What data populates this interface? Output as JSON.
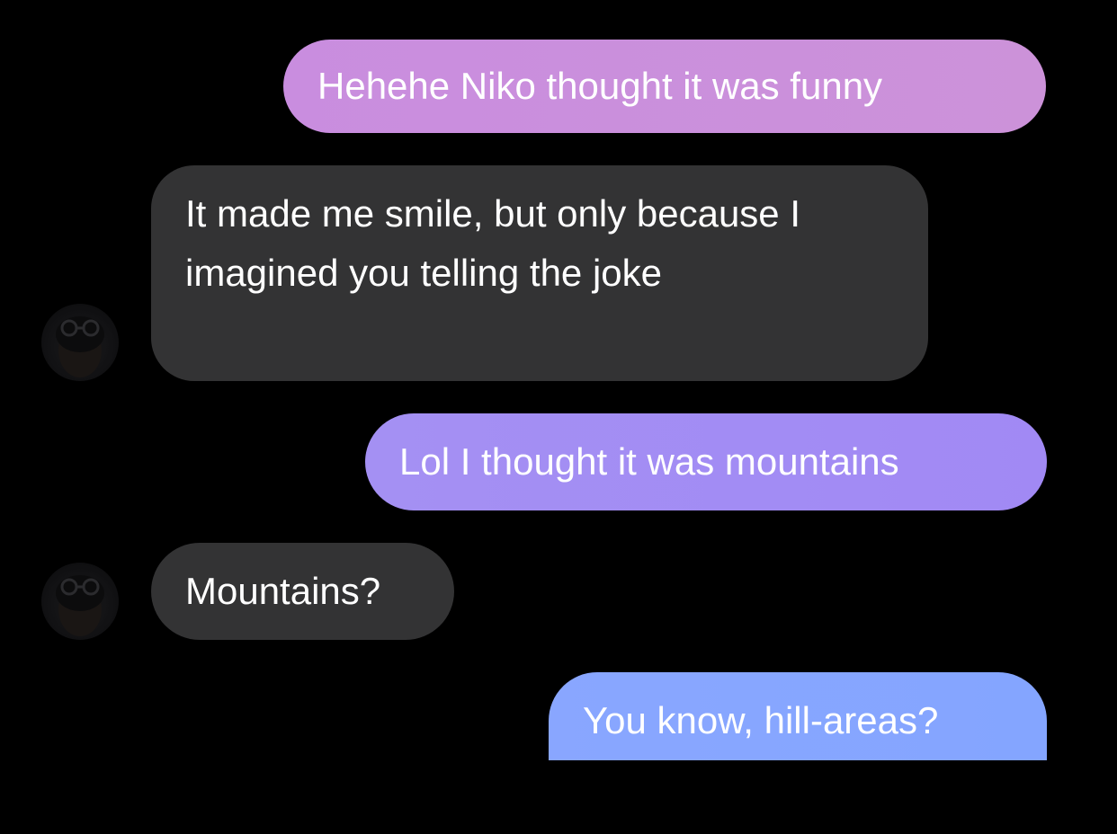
{
  "conversation": {
    "messages": [
      {
        "direction": "outgoing",
        "text": "Hehehe Niko thought it was funny"
      },
      {
        "direction": "incoming",
        "text": "It made me smile, but only because I imagined you telling the joke"
      },
      {
        "direction": "outgoing",
        "text": "Lol I thought it was mountains"
      },
      {
        "direction": "incoming",
        "text": "Mountains?"
      },
      {
        "direction": "outgoing",
        "text": "You know, hill-areas?"
      }
    ]
  },
  "colors": {
    "background": "#000000",
    "incoming_bubble": "#333334",
    "outgoing_bubble_1": "#cc90dc",
    "outgoing_bubble_2": "#a38cf4",
    "outgoing_bubble_3": "#87a6ff",
    "text": "#ffffff"
  },
  "icons": {
    "avatar": "contact-avatar-icon"
  }
}
